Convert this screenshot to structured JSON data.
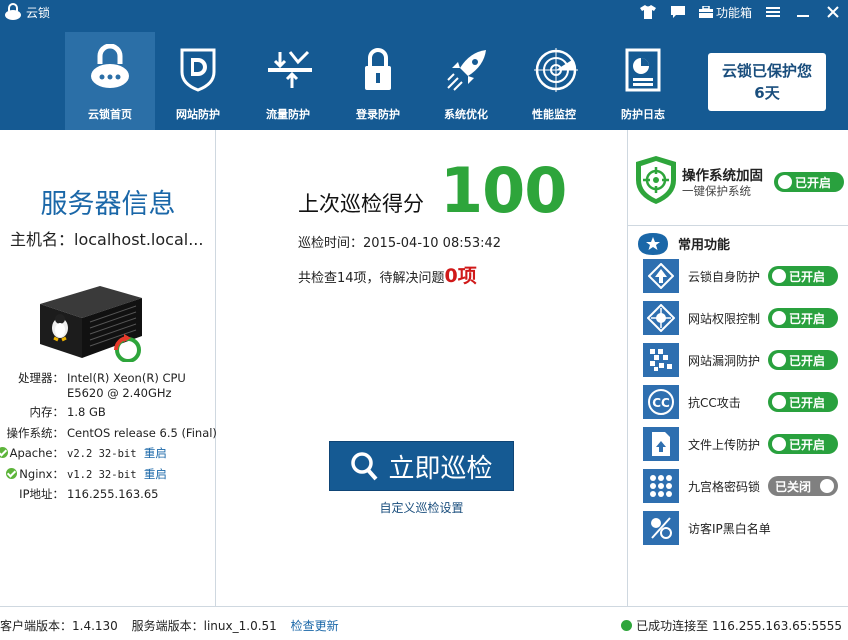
{
  "app": {
    "title": "云锁"
  },
  "titlebar": {
    "function_box": "功能箱"
  },
  "nav": {
    "items": [
      {
        "label": "云锁首页",
        "icon": "cloud-lock-icon"
      },
      {
        "label": "网站防护",
        "icon": "shield-d-icon"
      },
      {
        "label": "流量防护",
        "icon": "traffic-icon"
      },
      {
        "label": "登录防护",
        "icon": "padlock-icon"
      },
      {
        "label": "系统优化",
        "icon": "rocket-icon"
      },
      {
        "label": "性能监控",
        "icon": "radar-icon"
      },
      {
        "label": "防护日志",
        "icon": "report-icon"
      }
    ],
    "active": 0
  },
  "protect": {
    "line1": "云锁已保护您",
    "line2": "6天"
  },
  "server": {
    "title": "服务器信息",
    "hostname": "主机名：localhost.local...",
    "cpu_label": "处理器：",
    "cpu_value": "Intel(R) Xeon(R) CPU",
    "cpu_value2": "E5620  @ 2.40GHz",
    "mem_label": "内存：",
    "mem_value": "1.8 GB",
    "os_label": "操作系统：",
    "os_value": "CentOS release 6.5 (Final)",
    "apache_label": "Apache：",
    "apache_value": "v2.2 32-bit",
    "nginx_label": "Nginx：",
    "nginx_value": "v1.2 32-bit",
    "restart": "重启",
    "ip_label": "IP地址：",
    "ip_value": "116.255.163.65"
  },
  "scan": {
    "score_label": "上次巡检得分",
    "score": "100",
    "time": "巡检时间：2015-04-10 08:53:42",
    "count_text": "共检查14项，待解决问题",
    "pending": "0项",
    "button": "立即巡检",
    "custom_link": "自定义巡检设置"
  },
  "os_harden": {
    "title": "操作系统加固",
    "subtitle": "一键保护系统",
    "status": "已开启"
  },
  "common": {
    "title": "常用功能",
    "items": [
      {
        "name": "云锁自身防护",
        "status": "已开启",
        "on": true,
        "icon": "self-protect-icon"
      },
      {
        "name": "网站权限控制",
        "status": "已开启",
        "on": true,
        "icon": "permission-icon"
      },
      {
        "name": "网站漏洞防护",
        "status": "已开启",
        "on": true,
        "icon": "vuln-icon"
      },
      {
        "name": "抗CC攻击",
        "status": "已开启",
        "on": true,
        "icon": "cc-icon"
      },
      {
        "name": "文件上传防护",
        "status": "已开启",
        "on": true,
        "icon": "upload-icon"
      },
      {
        "name": "九宫格密码锁",
        "status": "已关闭",
        "on": false,
        "icon": "grid-lock-icon"
      },
      {
        "name": "访客IP黑白名单",
        "status": "",
        "on": null,
        "icon": "ip-list-icon"
      }
    ]
  },
  "status": {
    "client_version": "客户端版本：1.4.130",
    "server_version": "服务端版本：linux_1.0.51",
    "check_update": "检查更新",
    "connection": "已成功连接至 116.255.163.65:5555"
  },
  "colors": {
    "brand": "#155a93",
    "active_nav": "#2b6fa7",
    "on": "#29a13e",
    "off": "#808080",
    "score": "#2ea53b",
    "alert": "#d01919"
  }
}
